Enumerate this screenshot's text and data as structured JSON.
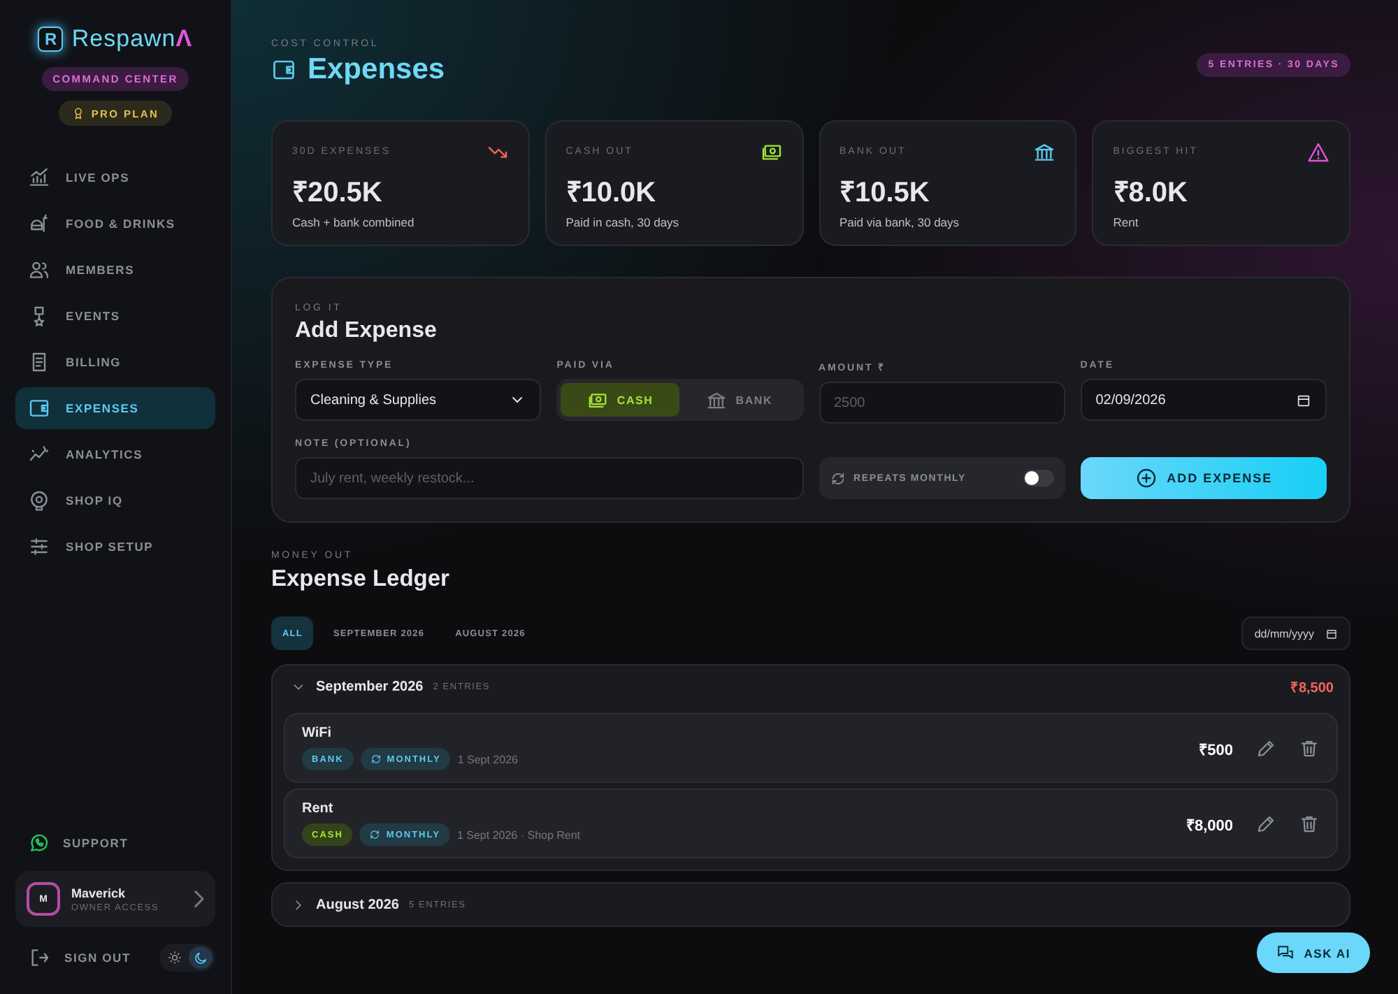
{
  "sidebar": {
    "brand": "Respawn",
    "brand_mark": "R",
    "brand_accent": "Λ",
    "badge": "COMMAND CENTER",
    "plan": "PRO PLAN",
    "items": [
      {
        "label": "LIVE OPS",
        "selected": false
      },
      {
        "label": "FOOD & DRINKS",
        "selected": false
      },
      {
        "label": "MEMBERS",
        "selected": false
      },
      {
        "label": "EVENTS",
        "selected": false
      },
      {
        "label": "BILLING",
        "selected": false
      },
      {
        "label": "EXPENSES",
        "selected": true
      },
      {
        "label": "ANALYTICS",
        "selected": false
      },
      {
        "label": "SHOP IQ",
        "selected": false
      },
      {
        "label": "SHOP SETUP",
        "selected": false
      }
    ],
    "support": "SUPPORT",
    "user": {
      "initial": "M",
      "name": "Maverick",
      "role": "OWNER ACCESS"
    },
    "sign_out": "SIGN OUT",
    "dark_mode": true
  },
  "header": {
    "eyebrow": "COST CONTROL",
    "title": "Expenses",
    "summary": "5 ENTRIES · 30 DAYS"
  },
  "stats": [
    {
      "label": "30D EXPENSES",
      "value": "₹20.5K",
      "note": "Cash + bank combined",
      "color": "#f0665a"
    },
    {
      "label": "CASH OUT",
      "value": "₹10.0K",
      "note": "Paid in cash, 30 days",
      "color": "#a3e635"
    },
    {
      "label": "BANK OUT",
      "value": "₹10.5K",
      "note": "Paid via bank, 30 days",
      "color": "#5ec8f0"
    },
    {
      "label": "BIGGEST HIT",
      "value": "₹8.0K",
      "note": "Rent",
      "color": "#e256d8"
    }
  ],
  "form": {
    "eyebrow": "LOG IT",
    "title": "Add Expense",
    "type_label": "EXPENSE TYPE",
    "type_value": "Cleaning & Supplies",
    "paid_label": "PAID VIA",
    "paid_options": [
      {
        "label": "CASH",
        "selected": true
      },
      {
        "label": "BANK",
        "selected": false
      }
    ],
    "amount_label": "AMOUNT ₹",
    "amount_placeholder": "2500",
    "date_label": "DATE",
    "date_value": "02/09/2026",
    "note_label": "NOTE (OPTIONAL)",
    "note_placeholder": "July rent, weekly restock...",
    "repeat_label": "REPEATS MONTHLY",
    "repeat_on": false,
    "submit": "ADD EXPENSE"
  },
  "ledger": {
    "eyebrow": "MONEY OUT",
    "title": "Expense Ledger",
    "tabs": [
      {
        "label": "ALL",
        "selected": true
      },
      {
        "label": "SEPTEMBER 2026",
        "selected": false
      },
      {
        "label": "AUGUST 2026",
        "selected": false
      }
    ],
    "date_placeholder": "dd/mm/yyyy",
    "groups": [
      {
        "title": "September 2026",
        "count": "2 ENTRIES",
        "total": "₹8,500",
        "expanded": true,
        "entries": [
          {
            "name": "WiFi",
            "tags": [
              {
                "kind": "bank",
                "label": "BANK"
              },
              {
                "kind": "monthly",
                "label": "MONTHLY"
              }
            ],
            "meta": "1 Sept 2026",
            "amount": "₹500"
          },
          {
            "name": "Rent",
            "tags": [
              {
                "kind": "cash",
                "label": "CASH"
              },
              {
                "kind": "monthly",
                "label": "MONTHLY"
              }
            ],
            "meta": "1 Sept 2026 · Shop Rent",
            "amount": "₹8,000"
          }
        ]
      },
      {
        "title": "August 2026",
        "count": "5 ENTRIES",
        "expanded": false
      }
    ]
  },
  "ask_ai": "ASK AI"
}
